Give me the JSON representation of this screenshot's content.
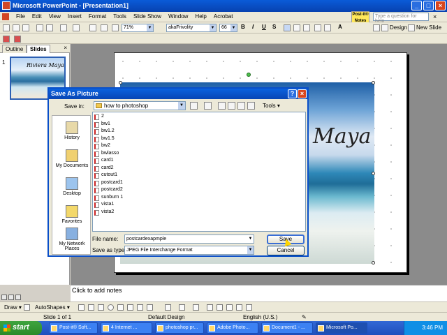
{
  "window": {
    "title": "Microsoft PowerPoint - [Presentation1]"
  },
  "menu": {
    "items": [
      "File",
      "Edit",
      "View",
      "Insert",
      "Format",
      "Tools",
      "Slide Show",
      "Window",
      "Help",
      "Acrobat"
    ],
    "help_placeholder": "Type a question for help",
    "postit_label": "Post-it® Notes"
  },
  "toolbar": {
    "zoom": "71%",
    "font": "akaFrivolity",
    "size": "66",
    "bold": "B",
    "italic": "I",
    "underline": "U",
    "shadow": "S",
    "design": "Design",
    "new_slide": "New Slide"
  },
  "panel": {
    "tab_outline": "Outline",
    "tab_slides": "Slides",
    "close": "×",
    "slide_number": "1",
    "thumb_text": "Riviera Maya"
  },
  "slide": {
    "title_text": "Maya"
  },
  "notes": {
    "placeholder": "Click to add notes"
  },
  "drawbar": {
    "draw": "Draw ▾",
    "autoshapes": "AutoShapes ▾"
  },
  "status": {
    "slide": "Slide 1 of 1",
    "design": "Default Design",
    "language": "English (U.S.)"
  },
  "taskbar": {
    "start": "start",
    "tasks": [
      "Post-it® Soft...",
      "4 Internet ...",
      "photoshop pr...",
      "Adobe Photo...",
      "Document1 - ...",
      "Microsoft Po..."
    ],
    "clock": "3:46 PM"
  },
  "dialog": {
    "title": "Save As Picture",
    "help": "?",
    "close": "×",
    "save_in_label": "Save in:",
    "save_in_value": "how to photoshop",
    "tools": "Tools ▾",
    "places": [
      "History",
      "My Documents",
      "Desktop",
      "Favorites",
      "My Network Places"
    ],
    "files": [
      "2",
      "bw1",
      "bw1.2",
      "bw1.5",
      "bw2",
      "bwlasso",
      "card1",
      "card2",
      "cutout1",
      "postcard1",
      "postcard2",
      "sunburn 1",
      "vista1",
      "vista2"
    ],
    "file_name_label": "File name:",
    "file_name_value": "postcardexapmple",
    "save_type_label": "Save as type:",
    "save_type_value": "JPEG File Interchange Format",
    "save_button": "Save",
    "cancel_button": "Cancel"
  }
}
